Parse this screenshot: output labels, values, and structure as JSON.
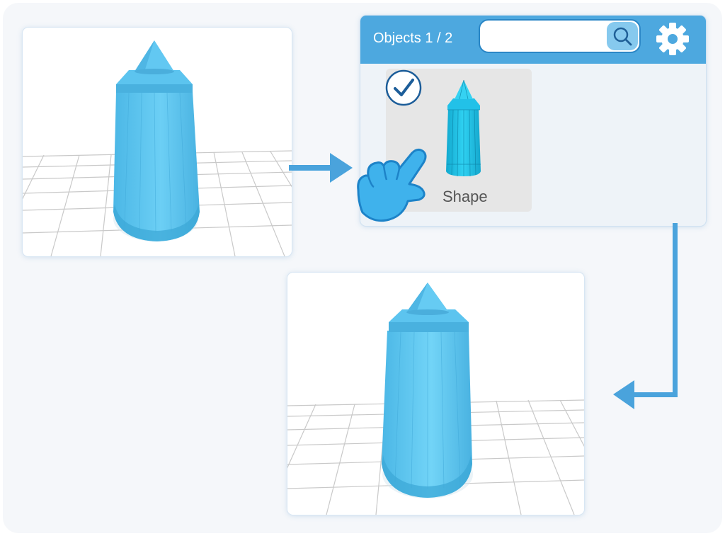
{
  "panel": {
    "title": "Objects 1 / 2",
    "search": {
      "value": "",
      "placeholder": ""
    }
  },
  "icons": {
    "search": "magnifier-icon",
    "settings": "gear-icon",
    "selected": "checkmark-icon",
    "cursor": "pointing-hand-icon"
  },
  "card": {
    "label": "Shape",
    "selected": true
  },
  "colors": {
    "accent": "#4da8df",
    "arrow": "#4aa3dc",
    "shape": "#56c2ee",
    "hand": "#3fb2ec",
    "check": "#1c5d99"
  }
}
